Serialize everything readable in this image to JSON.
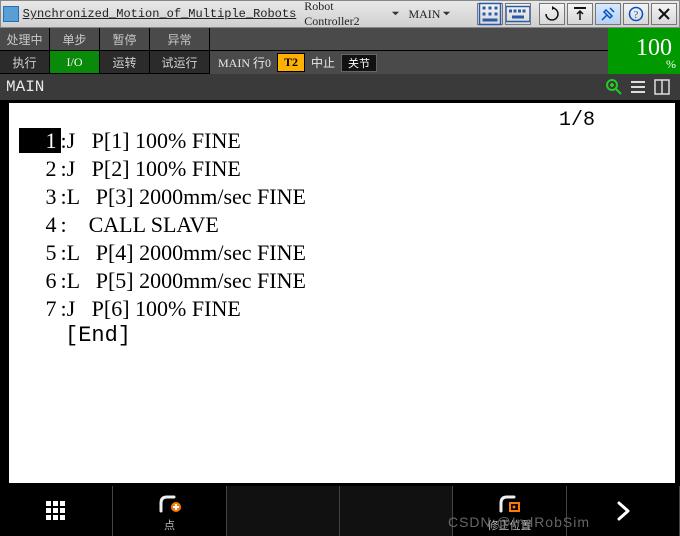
{
  "title_bar": {
    "project_name": "Synchronized_Motion_of_Multiple_Robots",
    "controller_dd": "Robot Controller2",
    "program_dd": "MAIN"
  },
  "status": {
    "row1": {
      "c1": "处理中",
      "c2": "单步",
      "c3": "暂停",
      "c4": "异常"
    },
    "row2": {
      "c1": "执行",
      "c2": "I/O",
      "c3": "运转",
      "c4": "试运行"
    },
    "info_prefix": "MAIN 行0",
    "mode_badge": "T2",
    "stop_text": "中止",
    "joint_badge": "关节",
    "override_value": "100",
    "override_unit": "%"
  },
  "sub_header": {
    "title": "MAIN"
  },
  "editor": {
    "line_counter": "1/8",
    "lines": [
      {
        "n": "1",
        "type": "J",
        "text": "P[1] 100% FINE",
        "selected": true
      },
      {
        "n": "2",
        "type": "J",
        "text": "P[2] 100% FINE",
        "selected": false
      },
      {
        "n": "3",
        "type": "L",
        "text": "P[3] 2000mm/sec FINE",
        "selected": false
      },
      {
        "n": "4",
        "type": "",
        "text": "CALL SLAVE",
        "selected": false
      },
      {
        "n": "5",
        "type": "L",
        "text": "P[4] 2000mm/sec FINE",
        "selected": false
      },
      {
        "n": "6",
        "type": "L",
        "text": "P[5] 2000mm/sec FINE",
        "selected": false
      },
      {
        "n": "7",
        "type": "J",
        "text": "P[6] 100% FINE",
        "selected": false
      }
    ],
    "end_label": "[End]"
  },
  "softkeys": {
    "k1_label": "",
    "k2_label": "点",
    "k3_label": "",
    "k4_label": "",
    "k5_label": "修正位置",
    "k6_label": ""
  },
  "watermark": "CSDN @IndRobSim"
}
